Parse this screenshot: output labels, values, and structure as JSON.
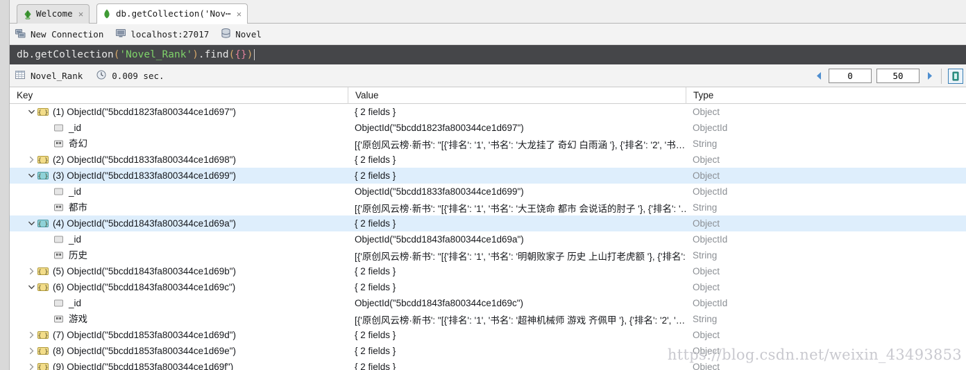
{
  "window": {
    "tabs": [
      {
        "label": "Welcome",
        "icon": "robo-logo-icon",
        "close": "×",
        "active": false
      },
      {
        "label": "db.getCollection('Nov⋯",
        "icon": "mongodb-leaf-icon",
        "close": "×",
        "active": true
      }
    ]
  },
  "connection_bar": {
    "items": [
      {
        "icon": "servers-icon",
        "label": "New Connection"
      },
      {
        "icon": "monitor-icon",
        "label": "localhost:27017"
      },
      {
        "icon": "database-icon",
        "label": "Novel"
      }
    ]
  },
  "query": {
    "tokens": [
      {
        "text": "db.getCollection",
        "kind": "plain"
      },
      {
        "text": "(",
        "kind": "paren"
      },
      {
        "text": "'Novel_Rank'",
        "kind": "string"
      },
      {
        "text": ")",
        "kind": "paren"
      },
      {
        "text": ".find",
        "kind": "plain"
      },
      {
        "text": "(",
        "kind": "paren"
      },
      {
        "text": "{}",
        "kind": "brace"
      },
      {
        "text": ")",
        "kind": "paren"
      }
    ],
    "full_text": "db.getCollection('Novel_Rank').find({})"
  },
  "result_bar": {
    "collection_icon": "grid-table-icon",
    "collection": "Novel_Rank",
    "time_icon": "clock-icon",
    "time": "0.009 sec.",
    "prev_icon": "arrow-left-icon",
    "next_icon": "arrow-right-icon",
    "skip_value": "0",
    "limit_value": "50",
    "view_icon": "tree-view-icon"
  },
  "table": {
    "columns": [
      "Key",
      "Value",
      "Type"
    ],
    "rows": [
      {
        "indent": 0,
        "twisty": "down",
        "icon": "document-icon",
        "key": "(1) ObjectId(\"5bcdd1823fa800344ce1d697\")",
        "value": "{ 2 fields }",
        "type": "Object",
        "selected": false
      },
      {
        "indent": 1,
        "twisty": "none",
        "icon": "objectid-icon",
        "key": "_id",
        "value": "ObjectId(\"5bcdd1823fa800344ce1d697\")",
        "type": "ObjectId",
        "selected": false
      },
      {
        "indent": 1,
        "twisty": "none",
        "icon": "string-icon",
        "key": "奇幻",
        "value": "[{'原创风云榜·新书': \"[{'排名': '1', '书名': '大龙挂了 奇幻 白雨涵 '}, {'排名': '2', '书…",
        "type": "String",
        "selected": false
      },
      {
        "indent": 0,
        "twisty": "right",
        "icon": "document-icon",
        "key": "(2) ObjectId(\"5bcdd1833fa800344ce1d698\")",
        "value": "{ 2 fields }",
        "type": "Object",
        "selected": false
      },
      {
        "indent": 0,
        "twisty": "down",
        "icon": "document-icon",
        "key": "(3) ObjectId(\"5bcdd1833fa800344ce1d699\")",
        "value": "{ 2 fields }",
        "type": "Object",
        "selected": true
      },
      {
        "indent": 1,
        "twisty": "none",
        "icon": "objectid-icon",
        "key": "_id",
        "value": "ObjectId(\"5bcdd1833fa800344ce1d699\")",
        "type": "ObjectId",
        "selected": false
      },
      {
        "indent": 1,
        "twisty": "none",
        "icon": "string-icon",
        "key": "都市",
        "value": "[{'原创风云榜·新书': \"[{'排名': '1', '书名': '大王饶命 都市 会说话的肘子 '}, {'排名': '…",
        "type": "String",
        "selected": false
      },
      {
        "indent": 0,
        "twisty": "down",
        "icon": "document-icon",
        "key": "(4) ObjectId(\"5bcdd1843fa800344ce1d69a\")",
        "value": "{ 2 fields }",
        "type": "Object",
        "selected": true
      },
      {
        "indent": 1,
        "twisty": "none",
        "icon": "objectid-icon",
        "key": "_id",
        "value": "ObjectId(\"5bcdd1843fa800344ce1d69a\")",
        "type": "ObjectId",
        "selected": false
      },
      {
        "indent": 1,
        "twisty": "none",
        "icon": "string-icon",
        "key": "历史",
        "value": "[{'原创风云榜·新书': \"[{'排名': '1', '书名': '明朝败家子 历史 上山打老虎额 '}, {'排名':…",
        "type": "String",
        "selected": false
      },
      {
        "indent": 0,
        "twisty": "right",
        "icon": "document-icon",
        "key": "(5) ObjectId(\"5bcdd1843fa800344ce1d69b\")",
        "value": "{ 2 fields }",
        "type": "Object",
        "selected": false
      },
      {
        "indent": 0,
        "twisty": "down",
        "icon": "document-icon",
        "key": "(6) ObjectId(\"5bcdd1843fa800344ce1d69c\")",
        "value": "{ 2 fields }",
        "type": "Object",
        "selected": false
      },
      {
        "indent": 1,
        "twisty": "none",
        "icon": "objectid-icon",
        "key": "_id",
        "value": "ObjectId(\"5bcdd1843fa800344ce1d69c\")",
        "type": "ObjectId",
        "selected": false
      },
      {
        "indent": 1,
        "twisty": "none",
        "icon": "string-icon",
        "key": "游戏",
        "value": "[{'原创风云榜·新书': \"[{'排名': '1', '书名': '超神机械师 游戏 齐佩甲 '}, {'排名': '2', '…",
        "type": "String",
        "selected": false
      },
      {
        "indent": 0,
        "twisty": "right",
        "icon": "document-icon",
        "key": "(7) ObjectId(\"5bcdd1853fa800344ce1d69d\")",
        "value": "{ 2 fields }",
        "type": "Object",
        "selected": false
      },
      {
        "indent": 0,
        "twisty": "right",
        "icon": "document-icon",
        "key": "(8) ObjectId(\"5bcdd1853fa800344ce1d69e\")",
        "value": "{ 2 fields }",
        "type": "Object",
        "selected": false
      },
      {
        "indent": 0,
        "twisty": "right",
        "icon": "document-icon",
        "key": "(9) ObjectId(\"5bcdd1853fa800344ce1d69f\")",
        "value": "{ 2 fields }",
        "type": "Object",
        "selected": false
      }
    ]
  },
  "watermark": "https://blog.csdn.net/weixin_43493853",
  "colors": {
    "selection": "#deeefc",
    "query_background": "#454649",
    "query_string": "#7fd36a",
    "query_paren": "#d8a96a",
    "query_brace": "#e0819b",
    "type_text": "#8b8f94",
    "accent_blue": "#3a7fb5"
  }
}
